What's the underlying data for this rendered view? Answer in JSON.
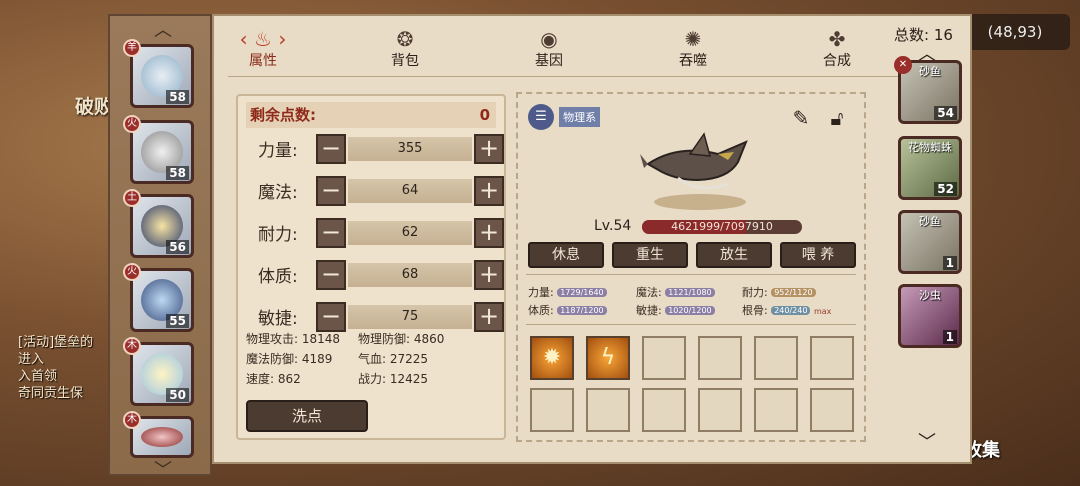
{
  "background": {
    "left_text": "破败",
    "chat_lines": [
      "[活动]堡垒的",
      "进入",
      "入首领",
      "奇同贡生保"
    ],
    "coordinate": "(48,93)",
    "collect_label": "收集"
  },
  "tabs": [
    {
      "label": "属性",
      "active": true,
      "icon": "flame-icon"
    },
    {
      "label": "背包",
      "active": false,
      "icon": "bag-icon"
    },
    {
      "label": "基因",
      "active": false,
      "icon": "gene-icon"
    },
    {
      "label": "吞噬",
      "active": false,
      "icon": "devour-icon"
    },
    {
      "label": "合成",
      "active": false,
      "icon": "synthesis-icon"
    }
  ],
  "left_pets": [
    {
      "level": "58"
    },
    {
      "level": "58"
    },
    {
      "level": "56"
    },
    {
      "level": "55"
    },
    {
      "level": "50"
    },
    {
      "level": ""
    }
  ],
  "points": {
    "remaining_label": "剩余点数:",
    "remaining_value": "0",
    "stats": [
      {
        "name": "力量:",
        "value": "355"
      },
      {
        "name": "魔法:",
        "value": "64"
      },
      {
        "name": "耐力:",
        "value": "62"
      },
      {
        "name": "体质:",
        "value": "68"
      },
      {
        "name": "敏捷:",
        "value": "75"
      }
    ],
    "battle": {
      "phys_atk": "物理攻击: 18148",
      "phys_def": "物理防御: 4860",
      "mag_def": "魔法防御: 4189",
      "hp": "气血: 27225",
      "speed": "速度: 862",
      "power": "战力: 12425"
    },
    "reset_label": "洗点"
  },
  "detail": {
    "class_label": "物理系",
    "level": "Lv.54",
    "hp_text": "4621999/7097910",
    "hp_fraction": 0.651,
    "actions": [
      "休息",
      "重生",
      "放生",
      "喂 养"
    ],
    "attrs": {
      "str_label": "力量:",
      "str_val": "1729/1640",
      "mag_label": "魔法:",
      "mag_val": "1121/1080",
      "end_label": "耐力:",
      "end_val": "952/1120",
      "con_label": "体质:",
      "con_val": "1187/1200",
      "agi_label": "敏捷:",
      "agi_val": "1020/1200",
      "root_label": "根骨:",
      "root_val": "240/240",
      "max_label": "max"
    }
  },
  "right_list": {
    "total_label": "总数: 16",
    "pets": [
      {
        "name": "砂鱼",
        "level": "54"
      },
      {
        "name": "花物蜘蛛",
        "level": "52"
      },
      {
        "name": "砂鱼",
        "level": "1"
      },
      {
        "name": "沙虫",
        "level": "1"
      }
    ]
  }
}
